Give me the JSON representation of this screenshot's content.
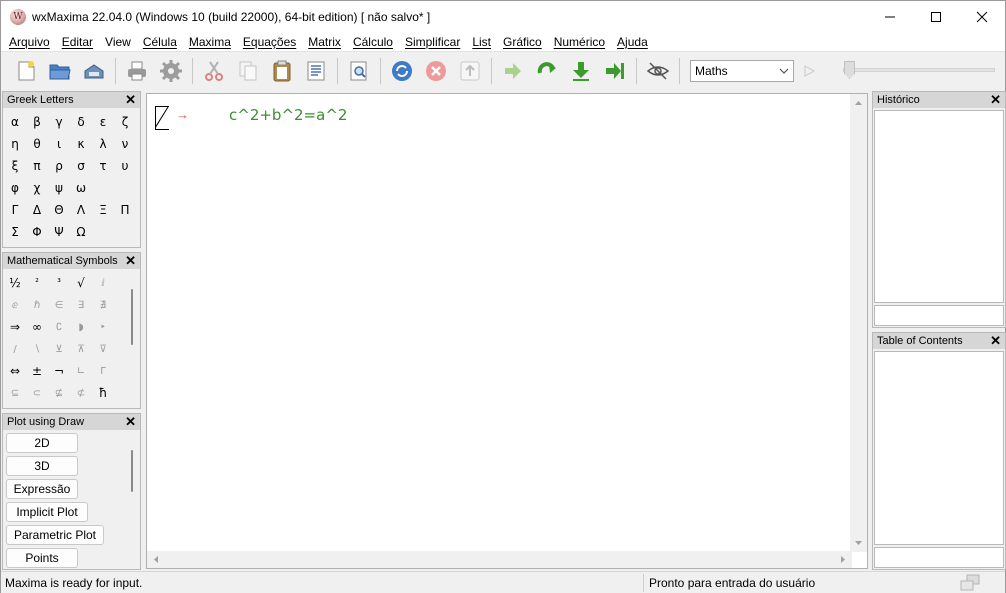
{
  "window": {
    "title": "wxMaxima 22.04.0 (Windows 10 (build 22000), 64-bit edition) [ não salvo* ]",
    "minimize_icon": "minimize-icon",
    "maximize_icon": "maximize-icon",
    "close_icon": "close-icon"
  },
  "menu": [
    "Arquivo",
    "Editar",
    "View",
    "Célula",
    "Maxima",
    "Equações",
    "Matrix",
    "Cálculo",
    "Simplificar",
    "List",
    "Gráfico",
    "Numérico",
    "Ajuda"
  ],
  "toolbar": {
    "mode_value": "Maths"
  },
  "greek": {
    "title": "Greek Letters",
    "close": "✕",
    "letters": [
      "α",
      "β",
      "γ",
      "δ",
      "ε",
      "ζ",
      "η",
      "θ",
      "ι",
      "κ",
      "λ",
      "ν",
      "ξ",
      "π",
      "ρ",
      "σ",
      "τ",
      "υ",
      "φ",
      "χ",
      "ψ",
      "ω",
      "",
      "",
      "Γ",
      "Δ",
      "Θ",
      "Λ",
      "Ξ",
      "Π",
      "Σ",
      "Φ",
      "Ψ",
      "Ω",
      "",
      ""
    ]
  },
  "math": {
    "title": "Mathematical Symbols",
    "close": "✕",
    "symbols": [
      "½",
      "²",
      "³",
      "√",
      "ⅈ",
      "",
      "ⅇ",
      "ℏ",
      "∈",
      "∃",
      "∄",
      "",
      "⇒",
      "∞",
      "∁",
      "◗",
      "‣",
      "",
      "/",
      "∖",
      "⊻",
      "⊼",
      "⊽",
      "",
      "⇔",
      "±",
      "¬",
      "∟",
      "Γ",
      "",
      "⊆",
      "⊂",
      "⊈",
      "⊄",
      "ħ",
      ""
    ]
  },
  "plot": {
    "title": "Plot using Draw",
    "close": "✕",
    "buttons": [
      "2D",
      "3D",
      "Expressão",
      "Implicit Plot",
      "Parametric Plot",
      "Points"
    ]
  },
  "worksheet": {
    "prompt": "→",
    "input_parts": [
      {
        "text": "c^2+b^2=",
        "color": "#3a8f2e"
      },
      {
        "text": "a",
        "color": "#3a8f2e"
      },
      {
        "text": "^2",
        "color": "#3a8f2e"
      }
    ]
  },
  "history": {
    "title": "Histórico",
    "close": "✕"
  },
  "toc": {
    "title": "Table of Contents",
    "close": "✕"
  },
  "status": {
    "left": "Maxima is ready for input.",
    "right": "Pronto para entrada do usuário"
  }
}
